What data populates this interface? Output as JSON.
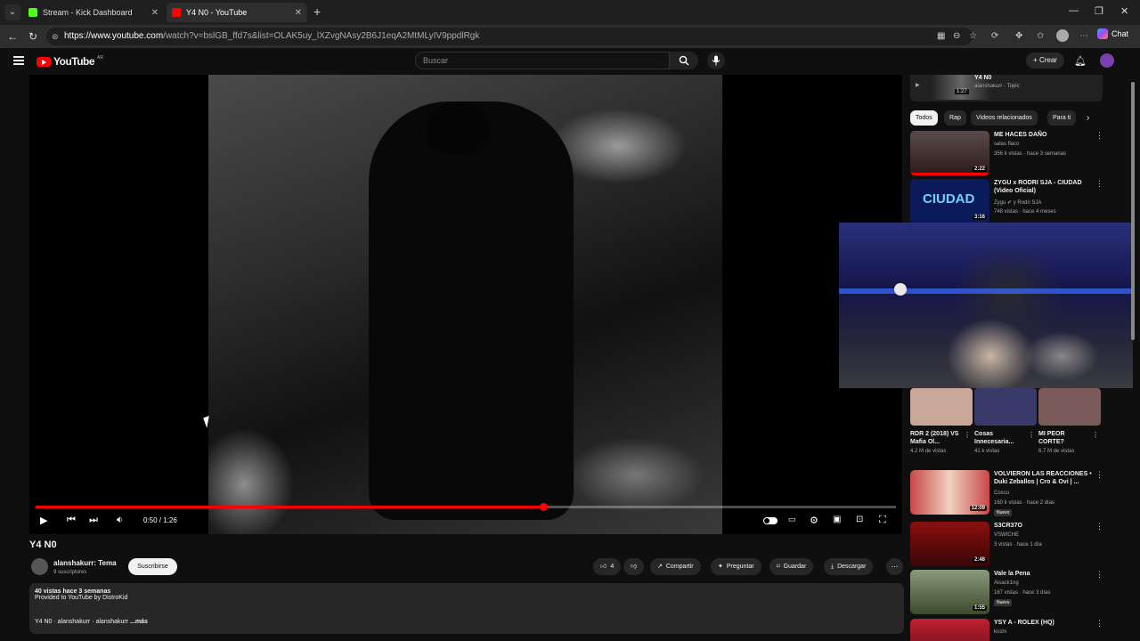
{
  "browser": {
    "tabs": [
      {
        "title": "Stream - Kick Dashboard",
        "favicon_color": "#53fc18"
      },
      {
        "title": "Y4 N0 - YouTube",
        "favicon_color": "#ff0000"
      }
    ],
    "url_host": "https://www.youtube.com",
    "url_path": "/watch?v=bslGB_ffd7s&list=OLAK5uy_lXZvgNAsy2B6J1eqA2MtMLyIV9ppdlRgk",
    "chat_label": "Chat"
  },
  "header": {
    "logo_text": "YouTube",
    "logo_country": "AR",
    "search_placeholder": "Buscar",
    "create_label": "Crear"
  },
  "player": {
    "progress_fraction": 0.59,
    "current_time": "0:50",
    "duration": "1:26",
    "time_text": "0:50 / 1:26"
  },
  "video": {
    "title": "Y4 N0",
    "channel_name": "alanshakurr: Tema",
    "subscribers": "9 suscriptores",
    "subscribe_label": "Suscribirse",
    "likes": "4",
    "share_label": "Compartir",
    "ask_label": "Preguntar",
    "save_label": "Guardar",
    "download_label": "Descargar",
    "description": {
      "stats": "40 vistas  hace 3 semanas",
      "line2": "Provided to YouTube by DistroKid",
      "line3": "Y4 N0 · alanshakurr · alanshakurr",
      "more": "...más"
    }
  },
  "sidebar": {
    "now_playing": {
      "title": "Y4 N0",
      "subtitle": "alanshakurr - Topic",
      "duration": "1:27"
    },
    "chips": [
      "Todos",
      "Rap",
      "Videos relacionados",
      "Para ti"
    ],
    "videos_top": [
      {
        "title": "ME HACES DAÑO",
        "channel": "salas flaco",
        "meta": "356 k vistas · hace 3 semanas",
        "duration": "2:22",
        "thumb": "#3a2a2a"
      },
      {
        "title": "ZYGU x RODRI SJA - CIUDAD (Video Oficial)",
        "channel": "Zygu ✔ y Rodri SJA",
        "meta": "748 vistas · hace 4 meses",
        "duration": "3:16",
        "thumb": "#0a1a5a",
        "thumb_text": "CIUDAD"
      }
    ],
    "shorts": [
      {
        "title": "RDR 2 (2018) VS Mafia Ol...",
        "views": "4.2 M de vistas",
        "thumb": "#c9a89a"
      },
      {
        "title": "Cosas Innecesaria...",
        "views": "41 k vistas",
        "thumb": "#3a3a6a"
      },
      {
        "title": "MI PEOR CORTE?",
        "views": "6.7 M de vistas",
        "thumb": "#7a5a5a"
      }
    ],
    "videos_bottom": [
      {
        "title": "VOLVIERON LAS REACCIONES • Duki Zeballos | Cro & Ovi | ...",
        "channel": "Coscu",
        "meta": "160 k vistas · hace 2 días",
        "duration": "12:09",
        "badge": "Nuevo",
        "thumb": "#a83838"
      },
      {
        "title": "S3CR37O",
        "channel": "VSWICHE",
        "meta": "3 vistas · hace 1 día",
        "duration": "2:48",
        "badge": "",
        "thumb": "#6a0a0a"
      },
      {
        "title": "Vale la Pena",
        "channel": "Aisack1ng",
        "meta": "167 vistas · hace 3 días",
        "duration": "1:55",
        "badge": "Nuevo",
        "thumb": "#5a6a4a"
      },
      {
        "title": "YSY A - ROLEX (HQ)",
        "channel": "koshi",
        "meta": "",
        "duration": "",
        "badge": "",
        "thumb": "#8a1a2a"
      }
    ]
  }
}
